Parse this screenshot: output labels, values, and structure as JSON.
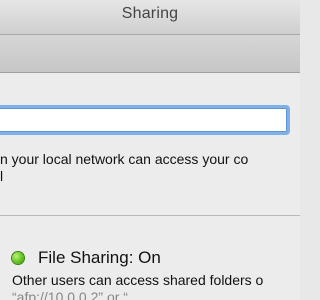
{
  "window": {
    "title": "Sharing"
  },
  "computer_name": {
    "value": ""
  },
  "access_info": {
    "line1": "n your local network can access your co",
    "line2": "l"
  },
  "file_sharing": {
    "status_label": "File Sharing: On",
    "status_color": "#62c21d",
    "description_line1": "Other users can access shared folders o",
    "description_line2": "“afp://10.0.0.2” or “"
  }
}
